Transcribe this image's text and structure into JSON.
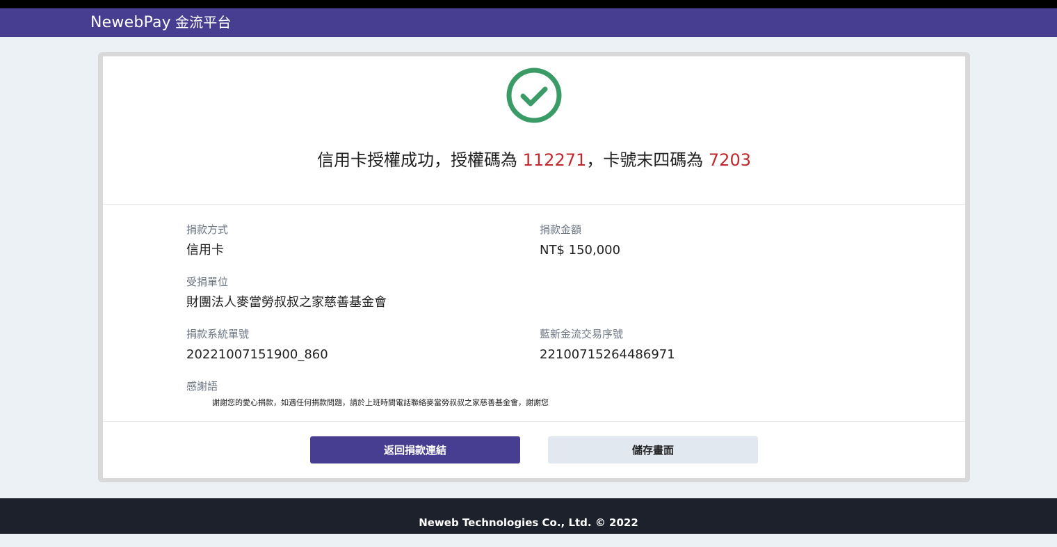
{
  "header": {
    "brand": "NewebPay",
    "brand_cn": "金流平台"
  },
  "result": {
    "text_prefix": "信用卡授權成功，授權碼為 ",
    "auth_code": "112271",
    "text_mid": "，卡號末四碼為 ",
    "card_last4": "7203"
  },
  "details": {
    "method_label": "捐款方式",
    "method_value": "信用卡",
    "amount_label": "捐款金額",
    "amount_value": "NT$ 150,000",
    "recipient_label": "受捐單位",
    "recipient_value": "財團法人麥當勞叔叔之家慈善基金會",
    "system_no_label": "捐款系統單號",
    "system_no_value": "20221007151900_860",
    "trade_no_label": "藍新金流交易序號",
    "trade_no_value": "22100715264486971",
    "thanks_label": "感謝語",
    "thanks_value": "謝謝您的愛心捐款，如遇任何捐款問題，請於上班時間電話聯絡麥當勞叔叔之家慈善基金會，謝謝您"
  },
  "buttons": {
    "back_label": "返回捐款連結",
    "save_label": "儲存畫面"
  },
  "footer": {
    "copyright": "Neweb Technologies Co., Ltd. © 2022"
  },
  "colors": {
    "brand": "#483e91",
    "success": "#3a9b66",
    "highlight": "#c0282d",
    "footer_bg": "#1d212b"
  },
  "icons": {
    "success": "check-circle-icon"
  }
}
